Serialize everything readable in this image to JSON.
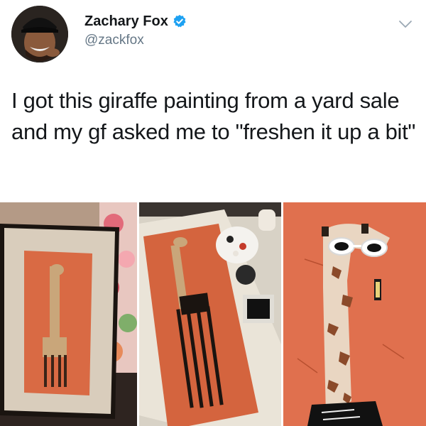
{
  "tweet": {
    "display_name": "Zachary Fox",
    "handle": "@zackfox",
    "text": "I got this giraffe painting from a yard sale and my gf asked me to \"freshen it up a bit\"",
    "verified": true
  },
  "icons": {
    "verified": "verified-badge-icon",
    "menu": "chevron-down-icon"
  },
  "colors": {
    "verified_blue": "#1da1f2",
    "text_primary": "#14171a",
    "text_secondary": "#657786",
    "painting_orange": "#e07050"
  },
  "photos": [
    {
      "id": "photo-original"
    },
    {
      "id": "photo-in-progress"
    },
    {
      "id": "photo-closeup"
    }
  ]
}
